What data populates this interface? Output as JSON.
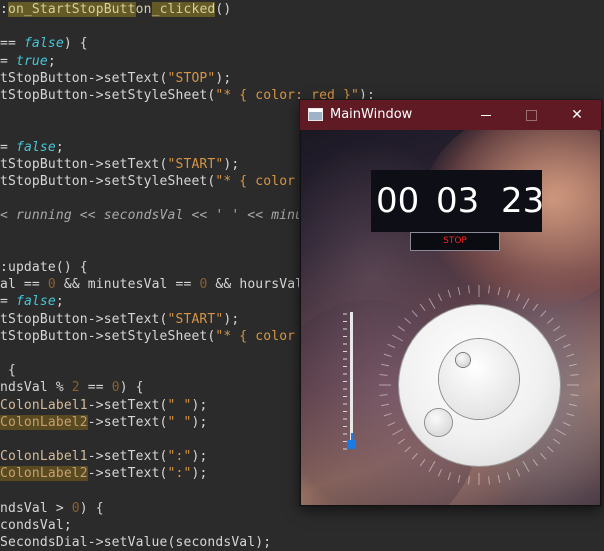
{
  "editor": {
    "lines": [
      {
        "segments": [
          {
            "t": ":",
            "c": "tok-op"
          },
          {
            "t": "on_StartStopButt",
            "c": "tok-hl"
          },
          {
            "t": "on",
            "c": "tok-fn"
          },
          {
            "t": "_clicked",
            "c": "tok-hl"
          },
          {
            "t": "()",
            "c": "tok-op"
          }
        ]
      },
      {
        "segments": []
      },
      {
        "segments": [
          {
            "t": "== ",
            "c": "tok-op"
          },
          {
            "t": "false",
            "c": "tok-kw"
          },
          {
            "t": ") {",
            "c": "tok-op"
          }
        ]
      },
      {
        "segments": [
          {
            "t": "= ",
            "c": "tok-op"
          },
          {
            "t": "true",
            "c": "tok-kw"
          },
          {
            "t": ";",
            "c": "tok-op"
          }
        ]
      },
      {
        "segments": [
          {
            "t": "tStopButton->setText(",
            "c": "tok-op"
          },
          {
            "t": "\"STOP\"",
            "c": "tok-str"
          },
          {
            "t": ");",
            "c": "tok-op"
          }
        ]
      },
      {
        "segments": [
          {
            "t": "tStopButton->setStyleSheet(",
            "c": "tok-op"
          },
          {
            "t": "\"* { color: red }\"",
            "c": "tok-str"
          },
          {
            "t": ");",
            "c": "tok-op"
          }
        ]
      },
      {
        "segments": []
      },
      {
        "segments": []
      },
      {
        "segments": [
          {
            "t": "= ",
            "c": "tok-op"
          },
          {
            "t": "false",
            "c": "tok-kw"
          },
          {
            "t": ";",
            "c": "tok-op"
          }
        ]
      },
      {
        "segments": [
          {
            "t": "tStopButton->setText(",
            "c": "tok-op"
          },
          {
            "t": "\"START\"",
            "c": "tok-str"
          },
          {
            "t": ");",
            "c": "tok-op"
          }
        ]
      },
      {
        "segments": [
          {
            "t": "tStopButton->setStyleSheet(",
            "c": "tok-op"
          },
          {
            "t": "\"* { color",
            "c": "tok-str"
          }
        ]
      },
      {
        "segments": []
      },
      {
        "segments": [
          {
            "t": "< running << secondsVal << ' ' << minu",
            "c": "tok-cm"
          }
        ]
      },
      {
        "segments": []
      },
      {
        "segments": []
      },
      {
        "segments": [
          {
            "t": ":update() {",
            "c": "tok-op"
          }
        ]
      },
      {
        "segments": [
          {
            "t": "al == ",
            "c": "tok-op"
          },
          {
            "t": "0",
            "c": "tok-num"
          },
          {
            "t": " && minutesVal == ",
            "c": "tok-op"
          },
          {
            "t": "0",
            "c": "tok-num"
          },
          {
            "t": " && hoursVal",
            "c": "tok-op"
          }
        ]
      },
      {
        "segments": [
          {
            "t": "= ",
            "c": "tok-op"
          },
          {
            "t": "false",
            "c": "tok-kw"
          },
          {
            "t": ";",
            "c": "tok-op"
          }
        ]
      },
      {
        "segments": [
          {
            "t": "tStopButton->setText(",
            "c": "tok-op"
          },
          {
            "t": "\"START\"",
            "c": "tok-str"
          },
          {
            "t": ");",
            "c": "tok-op"
          }
        ]
      },
      {
        "segments": [
          {
            "t": "tStopButton->setStyleSheet(",
            "c": "tok-op"
          },
          {
            "t": "\"* { color",
            "c": "tok-str"
          }
        ]
      },
      {
        "segments": []
      },
      {
        "segments": [
          {
            "t": " {",
            "c": "tok-op"
          }
        ]
      },
      {
        "segments": [
          {
            "t": "ndsVal % ",
            "c": "tok-op"
          },
          {
            "t": "2",
            "c": "tok-num"
          },
          {
            "t": " == ",
            "c": "tok-op"
          },
          {
            "t": "0",
            "c": "tok-num"
          },
          {
            "t": ") {",
            "c": "tok-op"
          }
        ]
      },
      {
        "segments": [
          {
            "t": "ColonLabel1",
            "c": "tok-ident"
          },
          {
            "t": "->setText(",
            "c": "tok-op"
          },
          {
            "t": "\" \"",
            "c": "tok-str"
          },
          {
            "t": ");",
            "c": "tok-op"
          }
        ]
      },
      {
        "segments": [
          {
            "t": "ColonLabel2",
            "c": "tok-hl2"
          },
          {
            "t": "->setText(",
            "c": "tok-op"
          },
          {
            "t": "\" \"",
            "c": "tok-str"
          },
          {
            "t": ");",
            "c": "tok-op"
          }
        ]
      },
      {
        "segments": []
      },
      {
        "segments": [
          {
            "t": "ColonLabel1",
            "c": "tok-ident"
          },
          {
            "t": "->setText(",
            "c": "tok-op"
          },
          {
            "t": "\":\"",
            "c": "tok-str"
          },
          {
            "t": ");",
            "c": "tok-op"
          }
        ]
      },
      {
        "segments": [
          {
            "t": "ColonLabel2",
            "c": "tok-hl2"
          },
          {
            "t": "->setText(",
            "c": "tok-op"
          },
          {
            "t": "\":\"",
            "c": "tok-str"
          },
          {
            "t": ");",
            "c": "tok-op"
          }
        ]
      },
      {
        "segments": []
      },
      {
        "segments": [
          {
            "t": "ndsVal > ",
            "c": "tok-op"
          },
          {
            "t": "0",
            "c": "tok-num"
          },
          {
            "t": ") {",
            "c": "tok-op"
          }
        ]
      },
      {
        "segments": [
          {
            "t": "condsVal;",
            "c": "tok-op"
          }
        ]
      },
      {
        "segments": [
          {
            "t": "SecondsDial->setValue(secondsVal);",
            "c": "tok-op"
          }
        ]
      }
    ]
  },
  "window": {
    "title": "MainWindow",
    "minimize_glyph": "—",
    "close_glyph": "✕",
    "icon": "app-window-icon",
    "titlebar_color": "#5f1a24"
  },
  "timer": {
    "hours": "00",
    "minutes": "03",
    "seconds": "23"
  },
  "stop_button": {
    "label": "STOP",
    "text_color": "#ff2020"
  },
  "slider": {
    "accent": "#1a7be8",
    "value_fraction": 0.05
  },
  "dial": {
    "value_seconds": 23
  }
}
